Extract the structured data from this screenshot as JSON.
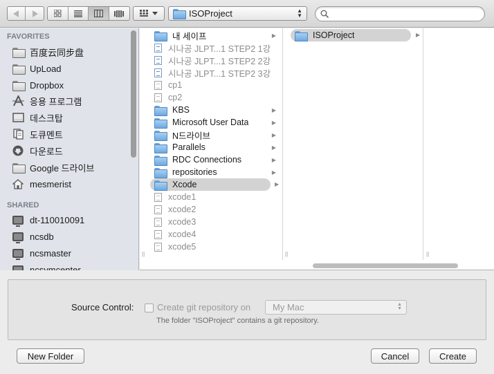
{
  "toolbar": {
    "back_icon": "chevron-left-icon",
    "forward_icon": "chevron-right-icon",
    "view_modes": [
      "icon-view",
      "list-view",
      "column-view",
      "coverflow-view"
    ],
    "active_view": "column-view",
    "path": "ISOProject",
    "search": {
      "value": "",
      "placeholder": ""
    }
  },
  "sidebar": {
    "favorites_header": "FAVORITES",
    "favorites": [
      {
        "label": "百度云同步盘",
        "icon": "folder-icon"
      },
      {
        "label": "UpLoad",
        "icon": "folder-icon"
      },
      {
        "label": "Dropbox",
        "icon": "folder-icon"
      },
      {
        "label": "응용 프로그램",
        "icon": "applications-icon"
      },
      {
        "label": "데스크탑",
        "icon": "desktop-icon"
      },
      {
        "label": "도큐멘트",
        "icon": "documents-icon"
      },
      {
        "label": "다운로드",
        "icon": "downloads-icon"
      },
      {
        "label": "Google 드라이브",
        "icon": "folder-icon"
      },
      {
        "label": "mesmerist",
        "icon": "home-icon"
      }
    ],
    "shared_header": "SHARED",
    "shared": [
      {
        "label": "dt-110010091",
        "icon": "computer-icon"
      },
      {
        "label": "ncsdb",
        "icon": "computer-icon"
      },
      {
        "label": "ncsmaster",
        "icon": "computer-icon"
      },
      {
        "label": "ncsymcenter",
        "icon": "computer-icon"
      }
    ]
  },
  "browser": {
    "column1": [
      {
        "label": "내 세이프",
        "type": "folder",
        "arrow": true
      },
      {
        "label": "시나공 JLPT...1 STEP2 1강",
        "type": "media",
        "dim": true
      },
      {
        "label": "시나공 JLPT...1 STEP2 2강",
        "type": "media",
        "dim": true
      },
      {
        "label": "시나공 JLPT...1 STEP2 3강",
        "type": "media",
        "dim": true
      },
      {
        "label": "cp1",
        "type": "doc",
        "dim": true
      },
      {
        "label": "cp2",
        "type": "doc",
        "dim": true
      },
      {
        "label": "KBS",
        "type": "folder",
        "arrow": true
      },
      {
        "label": "Microsoft User Data",
        "type": "folder",
        "arrow": true
      },
      {
        "label": "N드라이브",
        "type": "folder",
        "arrow": true
      },
      {
        "label": "Parallels",
        "type": "folder",
        "arrow": true
      },
      {
        "label": "RDC Connections",
        "type": "folder",
        "arrow": true
      },
      {
        "label": "repositories",
        "type": "folder",
        "arrow": true
      },
      {
        "label": "Xcode",
        "type": "folder",
        "arrow": true,
        "selected": true
      },
      {
        "label": "xcode1",
        "type": "doc",
        "dim": true
      },
      {
        "label": "xcode2",
        "type": "doc",
        "dim": true
      },
      {
        "label": "xcode3",
        "type": "doc",
        "dim": true
      },
      {
        "label": "xcode4",
        "type": "doc",
        "dim": true
      },
      {
        "label": "xcode5",
        "type": "doc",
        "dim": true
      }
    ],
    "column2": [
      {
        "label": "ISOProject",
        "type": "folder",
        "arrow": true,
        "selected": true
      }
    ]
  },
  "options": {
    "source_control_label": "Source Control:",
    "checkbox_label": "Create git repository on",
    "checkbox_checked": false,
    "location_popup": "My Mac",
    "note": "The folder \"ISOProject\" contains a git repository."
  },
  "buttons": {
    "new_folder": "New Folder",
    "cancel": "Cancel",
    "create": "Create"
  }
}
